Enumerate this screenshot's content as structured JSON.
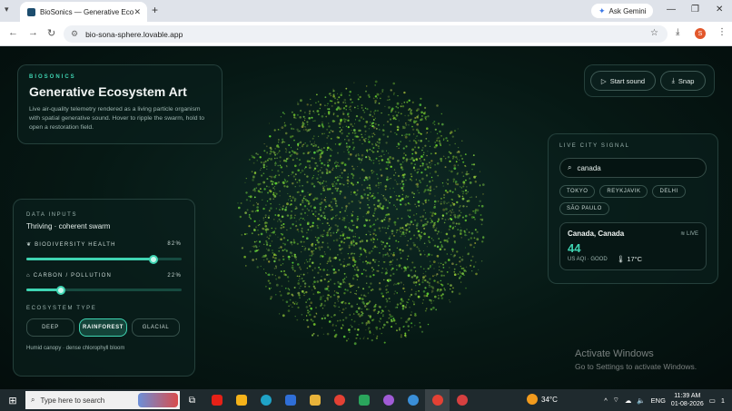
{
  "browser": {
    "tab_title": "BioSonics — Generative Ecosys",
    "new_tab": "+",
    "gemini": "Ask Gemini",
    "url": "bio-sona-sphere.lovable.app",
    "profile_initial": "S"
  },
  "hero": {
    "brand": "BIOSONICS",
    "title": "Generative Ecosystem Art",
    "description": "Live air-quality telemetry rendered as a living particle organism with spatial generative sound. Hover to ripple the swarm, hold to open a restoration field."
  },
  "controls": {
    "start_sound": "Start sound",
    "snap": "Snap"
  },
  "signal": {
    "label": "LIVE CITY SIGNAL",
    "search_value": "canada",
    "chips": [
      "TOKYO",
      "REYKJAVIK",
      "DELHI",
      "SÃO PAULO"
    ],
    "city_name": "Canada, Canada",
    "live": "LIVE",
    "aqi": "44",
    "aqi_label": "US AQI · GOOD",
    "temp": "17°C"
  },
  "inputs": {
    "label": "DATA INPUTS",
    "state": "Thriving · coherent swarm",
    "biodiversity_label": "BIODIVERSITY HEALTH",
    "biodiversity_value": "82%",
    "biodiversity": 0.82,
    "carbon_label": "CARBON / POLLUTION",
    "carbon_value": "22%",
    "carbon": 0.22,
    "ecosystem_label": "ECOSYSTEM TYPE",
    "ecosystem_types": [
      "DEEP",
      "RAINFOREST",
      "GLACIAL"
    ],
    "ecosystem_selected": "RAINFOREST",
    "ecosystem_desc": "Humid canopy · dense chlorophyll bloom"
  },
  "activate": {
    "title": "Activate Windows",
    "subtitle": "Go to Settings to activate Windows."
  },
  "taskbar": {
    "search_placeholder": "Type here to search",
    "temp": "34°C",
    "lang": "ENG",
    "time": "11:39 AM",
    "date": "01-08-2026",
    "notif_count": "1"
  },
  "colors": {
    "accent": "#3fd4b2",
    "particle": "#8ccf3a"
  }
}
